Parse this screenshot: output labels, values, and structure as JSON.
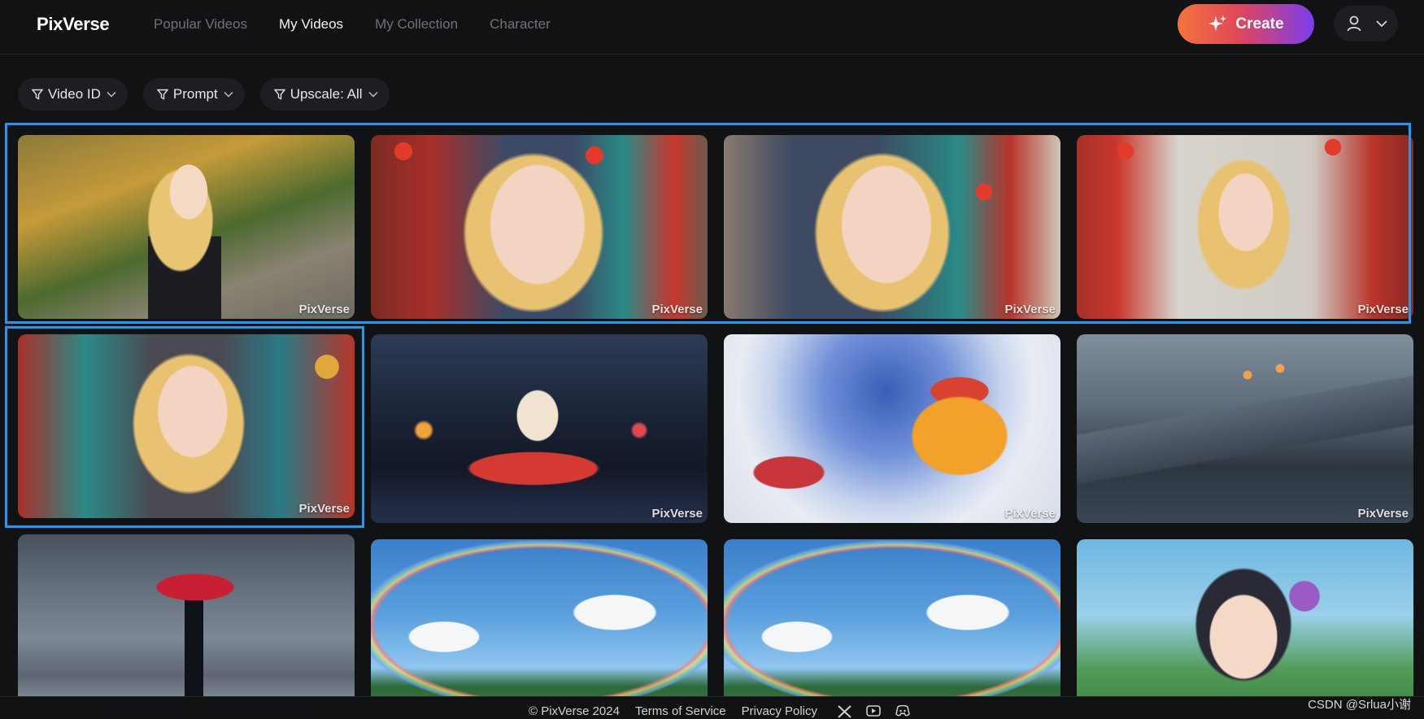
{
  "header": {
    "logo": "PixVerse",
    "nav": [
      {
        "label": "Popular Videos",
        "active": false
      },
      {
        "label": "My Videos",
        "active": true
      },
      {
        "label": "My Collection",
        "active": false
      },
      {
        "label": "Character",
        "active": false
      }
    ],
    "create_label": "Create",
    "user_icon": "user-icon",
    "menu_icon": "chevron-down-icon"
  },
  "filters": [
    {
      "label": "Video ID",
      "icon": "filter-icon"
    },
    {
      "label": "Prompt",
      "icon": "filter-icon"
    },
    {
      "label": "Upscale: All",
      "icon": "filter-icon"
    }
  ],
  "videos": [
    {
      "watermark": "PixVerse",
      "scene": "blonde woman on autumn park path"
    },
    {
      "watermark": "PixVerse",
      "scene": "blonde woman close-up on Chinese street"
    },
    {
      "watermark": "PixVerse",
      "scene": "blonde woman close-up on Chinese street"
    },
    {
      "watermark": "PixVerse",
      "scene": "blonde woman on Chinese street"
    },
    {
      "watermark": "PixVerse",
      "scene": "blonde woman on Chinese street with lanterns"
    },
    {
      "watermark": "PixVerse",
      "scene": "red paper boat in rain at night"
    },
    {
      "watermark": "PixVerse",
      "scene": "toy steamboat and orange hat boat"
    },
    {
      "watermark": "PixVerse",
      "scene": "large ship at dock in rain"
    },
    {
      "watermark": "",
      "scene": "woman with red umbrella on rainy pier"
    },
    {
      "watermark": "",
      "scene": "anime sky with rainbow"
    },
    {
      "watermark": "",
      "scene": "anime sky with rainbow"
    },
    {
      "watermark": "",
      "scene": "anime girl with purple flower"
    }
  ],
  "footer": {
    "copyright": "© PixVerse 2024",
    "terms": "Terms of Service",
    "privacy": "Privacy Policy",
    "social_icons": [
      "x-icon",
      "youtube-icon",
      "discord-icon"
    ]
  },
  "overlay_credit": "CSDN @Srlua小谢",
  "colors": {
    "selection": "#1e9bf0",
    "create_gradient": [
      "#f3743c",
      "#e0465a",
      "#7a3cf0"
    ]
  }
}
